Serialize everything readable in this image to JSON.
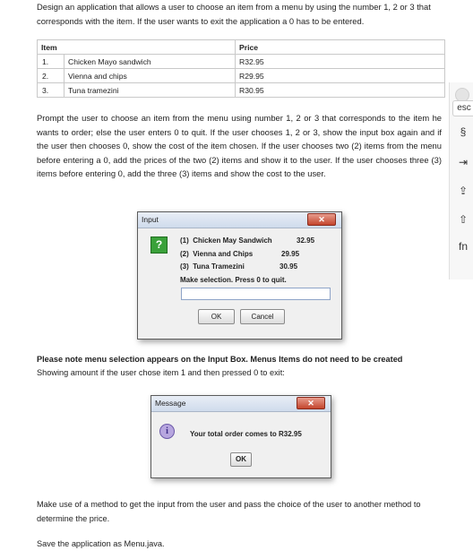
{
  "intro": "Design an application that allows a user to choose an item from a menu by using the number 1, 2 or 3 that corresponds with the item. If the user wants to exit the application a 0 has to be entered.",
  "table": {
    "headers": [
      "Item",
      "Price"
    ],
    "rows": [
      {
        "num": "1.",
        "item": "Chicken Mayo sandwich",
        "price": "R32.95"
      },
      {
        "num": "2.",
        "item": "Vienna and chips",
        "price": "R29.95"
      },
      {
        "num": "3.",
        "item": "Tuna tramezini",
        "price": "R30.95"
      }
    ]
  },
  "prompt": "Prompt the user to choose an item from the menu using number 1, 2 or 3 that corresponds to the item he wants to order; else the user enters 0 to quit. If the user chooses 1, 2 or 3, show the input box again and if the user then chooses 0, show the cost of the item chosen. If the user chooses two (2) items from the menu before entering a 0, add the prices of the two (2) items and show it to the user. If the user chooses three (3) items before entering 0, add the three (3) items and show the cost to the user.",
  "input_dialog": {
    "title": "Input",
    "icon": "question-icon",
    "lines": [
      {
        "label": "(1)  Chicken May Sandwich",
        "price": "32.95"
      },
      {
        "label": "(2)  Vienna and Chips",
        "price": "29.95"
      },
      {
        "label": "(3)  Tuna Tramezini",
        "price": "30.95"
      }
    ],
    "instruction": "Make selection. Press 0 to quit.",
    "input_value": "",
    "ok_label": "OK",
    "cancel_label": "Cancel"
  },
  "note_bold": "Please note menu selection appears on the Input Box. Menus Items do not need to be created",
  "note_sub": "Showing amount if the user chose item 1 and then pressed 0 to exit:",
  "message_dialog": {
    "title": "Message",
    "icon": "info-icon",
    "text": "Your total order comes to R32.95",
    "ok_label": "OK"
  },
  "method": "Make use of a method to get the input from the user and pass the choice of the user to another method to determine the price.",
  "save": "Save the application as Menu.java.",
  "sidebar": {
    "keys": [
      "esc",
      "§",
      "⇥",
      "⇪",
      "⇧",
      "fn"
    ]
  },
  "colors": {
    "question_icon": "#3aa13a",
    "info_icon": "#b7a6df",
    "close_button": "#c4452d"
  }
}
